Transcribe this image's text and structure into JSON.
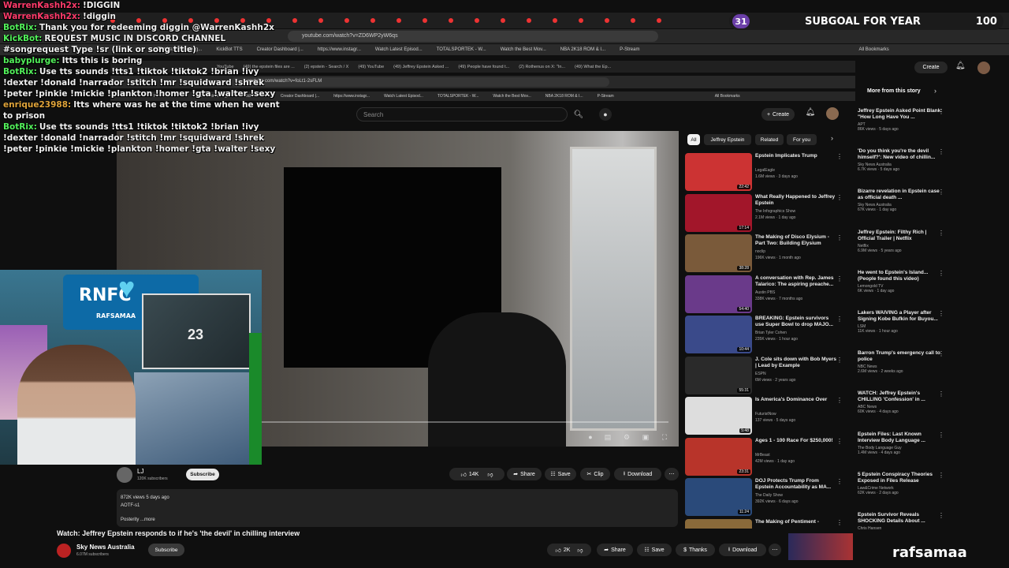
{
  "subgoal": {
    "number": "31",
    "text": "SUBGOAL FOR YEAR",
    "count": "100"
  },
  "outer_browser": {
    "url": "youtube.com/watch?v=ZD6WP2yW6qs",
    "bookmarks": [
      "The best streaming...",
      "KickBot TTS",
      "Creator Dashboard |...",
      "https://www.instagr...",
      "Watch Latest Episod...",
      "TOTALSPORTEK - W...",
      "Watch the Best Mov...",
      "NBA 2K18 ROM & I...",
      "P-Stream",
      "All Bookmarks"
    ]
  },
  "inner_browser": {
    "tabs": [
      "YouTube",
      "(49) the epstein files are ...",
      "(2) epstein - Search / X",
      "(49) YouTube",
      "(49) Jeffrey Epstein Asked ...",
      "(49) People have found t...",
      "(2) Rothenus on X: \"In...",
      "(49) What the Ep..."
    ],
    "url": "youtube.com/watch?v=foLt1-2sFLM",
    "bookmarks": [
      "Home / Twitter",
      "The best streaming...",
      "KickBot TTS",
      "Creator Dashboard |...",
      "https://www.instagr...",
      "Watch Latest Episod...",
      "TOTALSPORTEK - W...",
      "Watch the Best Mov...",
      "NBA 2K18 ROM & I...",
      "P-Stream",
      "All Bookmarks"
    ]
  },
  "yt": {
    "search_placeholder": "Search",
    "create": "Create",
    "notif_count": "9+",
    "chips": [
      "All",
      "Jeffrey Epstein",
      "Related",
      "For you"
    ],
    "channel": {
      "name": "LJ",
      "subs": "120K subscribers",
      "subscribe": "Subscribe"
    },
    "actions": {
      "likes": "14K",
      "share": "Share",
      "save": "Save",
      "clip": "Clip",
      "download": "Download"
    },
    "description": {
      "views": "872K views  5 days ago",
      "line2": "AOTF-s1",
      "line3": "Posterity",
      "more": "...more"
    }
  },
  "recommendations": [
    {
      "title": "Epstein Implicates Trump",
      "channel": "LegalEagle",
      "meta": "1.6M views · 3 days ago",
      "duration": "22:42",
      "bg": "#c33"
    },
    {
      "title": "What Really Happened to Jeffrey Epstein",
      "channel": "The Infographics Show",
      "meta": "2.1M views · 1 day ago",
      "duration": "17:14",
      "bg": "#a2162a"
    },
    {
      "title": "The Making of Disco Elysium - Part Two: Building Elysium",
      "channel": "noclip",
      "meta": "196K views · 1 month ago",
      "duration": "38:28",
      "bg": "#7a5a3a"
    },
    {
      "title": "A conversation with Rep. James Talarico: The aspiring preache...",
      "channel": "Austin PBS",
      "meta": "338K views · 7 months ago",
      "duration": "54:40",
      "bg": "#6a3a8a"
    },
    {
      "title": "BREAKING: Epstein survivors use Super Bowl to drop MAJO...",
      "channel": "Brian Tyler Cohen",
      "meta": "235K views · 1 hour ago",
      "duration": "10:44",
      "bg": "#3a4a8a"
    },
    {
      "title": "J. Cole sits down with Bob Myers | Lead by Example",
      "channel": "ESPN",
      "meta": "6M views · 2 years ago",
      "duration": "55:31",
      "bg": "#2a2a2a"
    },
    {
      "title": "Is America's Dominance Over",
      "channel": "FuturistNow",
      "meta": "137 views · 5 days ago",
      "duration": "5:48",
      "bg": "#ddd"
    },
    {
      "title": "Ages 1 - 100 Race For $250,000!",
      "channel": "MrBeast",
      "meta": "42M views · 1 day ago",
      "duration": "23:31",
      "bg": "#b8342a"
    },
    {
      "title": "DOJ Protects Trump From Epstein Accountability as MA...",
      "channel": "The Daily Show",
      "meta": "392K views · 6 days ago",
      "duration": "11:24",
      "bg": "#2a4a7a"
    },
    {
      "title": "The Making of Pentiment -",
      "channel": "",
      "meta": "",
      "duration": "",
      "bg": "#8a6a3a"
    }
  ],
  "outer_side": {
    "create": "Create",
    "more_from": "More from this story",
    "items": [
      {
        "title": "Jeffrey Epstein Asked Point Blank: \"How Long Have You ...",
        "channel": "APT",
        "meta": "86K views · 5 days ago"
      },
      {
        "title": "'Do you think you're the devil himself?': New video of chillin...",
        "channel": "Sky News Australia",
        "meta": "6.7K views · 5 days ago"
      },
      {
        "title": "Bizarre revelation in Epstein case as official death ...",
        "channel": "Sky News Australia",
        "meta": "67K views · 1 day ago"
      },
      {
        "title": "Jeffrey Epstein: Filthy Rich | Official Trailer | Netflix",
        "channel": "Netflix",
        "meta": "6.9M views · 5 years ago"
      },
      {
        "title": "He went to Epstein's Island... (People found this video)",
        "channel": "Lemongold TV",
        "meta": "6K views · 1 day ago"
      },
      {
        "title": "Lakers WAIVING a Player after Signing Kobe Bufkin for Buyou...",
        "channel": "LSM",
        "meta": "11K views · 1 hour ago"
      },
      {
        "title": "Barron Trump's emergency call to police",
        "channel": "NBC News",
        "meta": "2.6M views · 2 weeks ago"
      },
      {
        "title": "WATCH: Jeffrey Epstein's CHILLING 'Confession' in ...",
        "channel": "ABC News",
        "meta": "60K views · 4 days ago"
      },
      {
        "title": "Epstein Files: Last Known Interview Body Language ...",
        "channel": "The Body Language Guy",
        "meta": "1.4M views · 4 days ago"
      },
      {
        "title": "5 Epstein Conspiracy Theories Exposed in Files Release",
        "channel": "Law&Crime Network",
        "meta": "62K views · 2 days ago"
      },
      {
        "title": "Epstein Survivor Reveals SHOCKING Details About ...",
        "channel": "Chris Hansen",
        "meta": ""
      }
    ]
  },
  "bottom": {
    "title": "Watch: Jeffrey Epstein responds to if he's 'the devil' in chilling interview",
    "channel": "Sky News Australia",
    "subs": "6.07M subscribers",
    "subscribe": "Subscribe",
    "likes": "2K",
    "share": "Share",
    "save": "Save",
    "thanks": "Thanks",
    "download": "Download",
    "streamer": "rafsamaa"
  },
  "chat": [
    {
      "user": "WarrenKashh2x:",
      "msg": "!DIGGIN",
      "color": "#ff3b6b"
    },
    {
      "user": "WarrenKashh2x:",
      "msg": "!diggin",
      "color": "#ff3b6b"
    },
    {
      "user": "BotRix:",
      "msg": "Thank you for redeeming diggin @WarrenKashh2x",
      "color": "#52f05a"
    },
    {
      "user": "KickBot:",
      "msg": "REQUEST MUSIC IN DISCORD CHANNEL #songrequest Type !sr (link or song title)",
      "color": "#52f05a"
    },
    {
      "user": "babyplurge:",
      "msg": "Itts this is boring",
      "color": "#52f05a"
    },
    {
      "user": "BotRix:",
      "msg": "Use tts sounds !tts1 !tiktok !tiktok2 !brian !ivy !dexter !donald !narrador !stitch !mr !squidward !shrek !peter !pinkie !mickie !plankton !homer !gta !walter !sexy",
      "color": "#52f05a"
    },
    {
      "user": "enrique23988:",
      "msg": "Itts where was he at the time when he went to prison",
      "color": "#e0a43a"
    },
    {
      "user": "BotRix:",
      "msg": "Use tts sounds !tts1 !tiktok !tiktok2 !brian !ivy !dexter !donald !narrador !stitch !mr !squidward !shrek !peter !pinkie !mickie !plankton !homer !gta !walter !sexy",
      "color": "#52f05a"
    }
  ],
  "cam": {
    "banner": "RNFC",
    "sub": "RAFSAMAA",
    "jersey": "23"
  }
}
